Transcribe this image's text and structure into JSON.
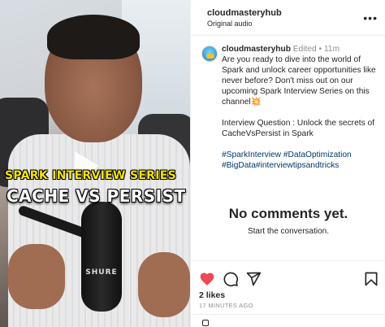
{
  "media": {
    "overlay_title_1": "SPARK INTERVIEW SERIES",
    "overlay_title_2": "CACHE VS PERSIST",
    "mic_brand": "SHURE"
  },
  "header": {
    "username": "cloudmasteryhub",
    "audio": "Original audio",
    "more_label": "•••"
  },
  "caption": {
    "username": "cloudmasteryhub",
    "edited": "Edited",
    "separator": " • ",
    "time": "11m",
    "paragraph_1": "Are you ready to dive into the world of Spark and unlock career opportunities like never before? Don't miss out on our upcoming Spark Interview Series on this channel💥",
    "paragraph_2": "Interview Question : Unlock the secrets of CacheVsPersist in Spark",
    "hashtags_line_1": "#SparkInterview #DataOptimization",
    "hashtags_line_2": "#BigData#interviewtipsandtricks"
  },
  "comments": {
    "empty_title": "No comments yet.",
    "empty_subtitle": "Start the conversation."
  },
  "actions": {
    "like_icon": "heart-icon",
    "comment_icon": "comment-icon",
    "share_icon": "share-icon",
    "save_icon": "bookmark-icon",
    "like_color": "#ed4956",
    "likes": "2 likes",
    "time_ago": "17 MINUTES AGO"
  }
}
